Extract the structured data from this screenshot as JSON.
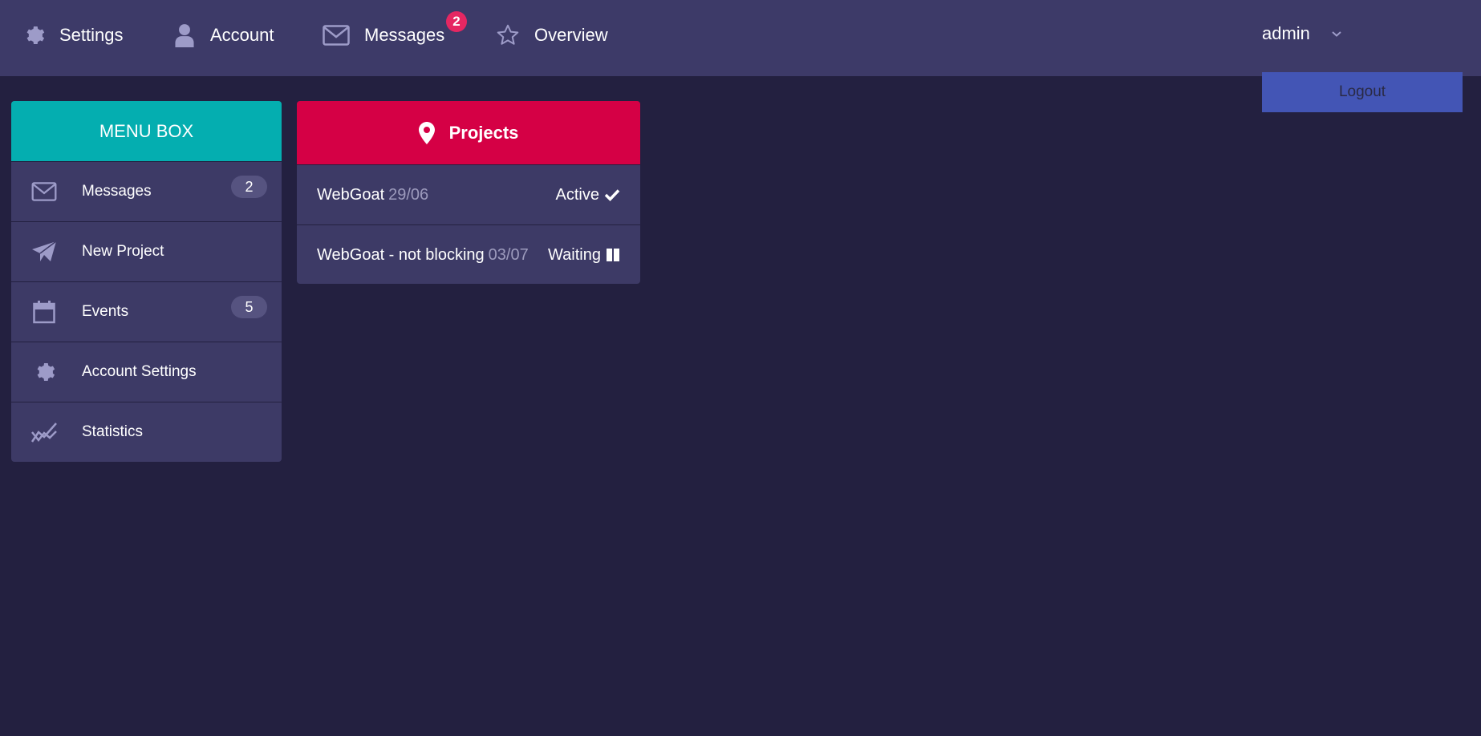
{
  "topnav": {
    "items": [
      {
        "label": "Settings",
        "icon": "gear-icon"
      },
      {
        "label": "Account",
        "icon": "user-icon"
      },
      {
        "label": "Messages",
        "icon": "envelope-icon",
        "badge": "2"
      },
      {
        "label": "Overview",
        "icon": "star-icon"
      }
    ],
    "user": {
      "name": "admin",
      "icon": "chevron-down-icon"
    },
    "logout_label": "Logout"
  },
  "menubox": {
    "title": "MENU BOX",
    "items": [
      {
        "label": "Messages",
        "icon": "envelope-icon",
        "count": "2"
      },
      {
        "label": "New Project",
        "icon": "paper-plane-icon"
      },
      {
        "label": "Events",
        "icon": "calendar-icon",
        "count": "5"
      },
      {
        "label": "Account Settings",
        "icon": "gear-icon"
      },
      {
        "label": "Statistics",
        "icon": "line-chart-icon"
      }
    ]
  },
  "projects": {
    "title": "Projects",
    "icon": "map-pin-icon",
    "rows": [
      {
        "name": "WebGoat",
        "date": "29/06",
        "status": "Active",
        "status_icon": "check-icon"
      },
      {
        "name": "WebGoat - not blocking",
        "date": "03/07",
        "status": "Waiting",
        "status_icon": "pause-icon"
      }
    ]
  },
  "colors": {
    "background": "#232040",
    "panel": "#3d3a66",
    "menubox_header": "#04aeb0",
    "projects_header": "#d50045",
    "badge": "#e52762",
    "logout": "#4355b5",
    "icon": "#9d9bc8"
  }
}
